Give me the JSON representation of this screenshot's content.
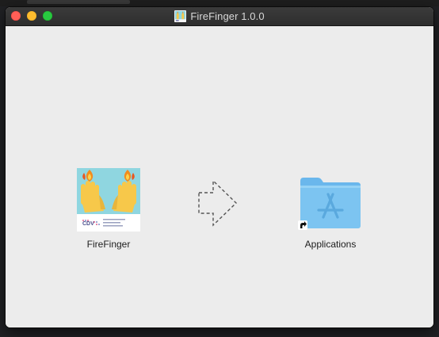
{
  "window": {
    "title": "FireFinger 1.0.0",
    "title_icon": "app-thumbnail-icon"
  },
  "items": {
    "app": {
      "label": "FireFinger",
      "icon": "firefinger-app-icon",
      "icon_text": "CDV"
    },
    "arrow": {
      "icon": "dashed-arrow-right-icon"
    },
    "applications": {
      "label": "Applications",
      "icon": "applications-folder-icon",
      "badge": "alias-arrow-icon"
    }
  },
  "colors": {
    "close": "#ff5f57",
    "minimize": "#febc2e",
    "zoom": "#28c840",
    "folder": "#7cc4f1",
    "icon_background": "#8fd6e0",
    "hands": "#f7c84a"
  }
}
